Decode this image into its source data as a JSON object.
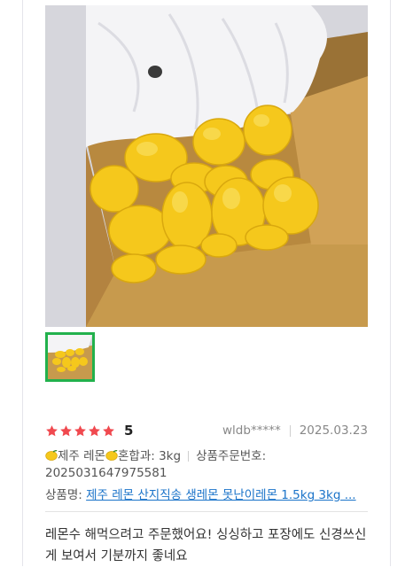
{
  "review": {
    "rating": "5",
    "stars": 5,
    "author": "wldb*****",
    "date": "2025.03.23",
    "option_label": "제주 레몬",
    "option_value": "혼합과: 3kg",
    "order_label": "상품주문번호:",
    "order_number": "2025031647975581",
    "product_label": "상품명:",
    "product_name": "제주 레몬 산지직송 생레몬 못난이레몬 1.5kg 3kg ...",
    "body": "레몬수 해먹으려고 주문했어요! 싱싱하고 포장에도 신경쓰신게 보여서 기분까지 좋네요"
  },
  "colors": {
    "star": "#f0494f",
    "link": "#1a73c9",
    "thumb_border": "#22b14c"
  },
  "icons": {
    "photo": "lemon-box-photo",
    "thumbnail": "lemon-box-thumbnail",
    "star": "star-icon",
    "lemon": "lemon-emoji-icon"
  }
}
